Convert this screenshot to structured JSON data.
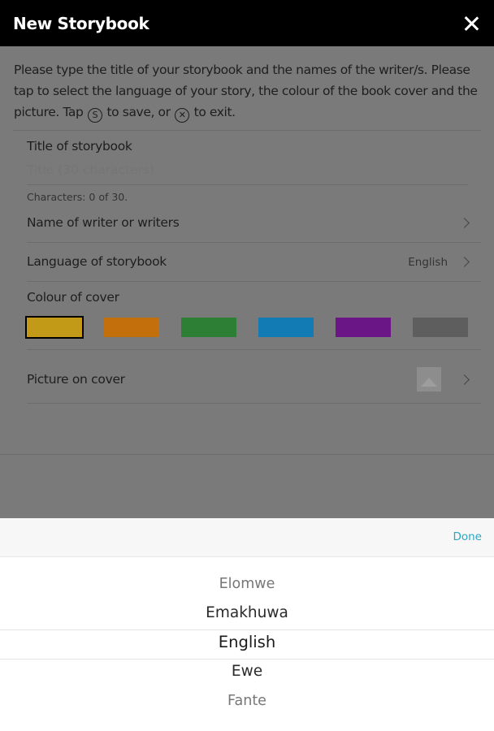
{
  "header": {
    "title": "New Storybook",
    "close_icon": "close-icon"
  },
  "form": {
    "intro_part1": "Please type the title of your storybook and the names of the writer/s. Please tap to select the language of your story, the colour of the book cover and the picture. Tap ",
    "save_glyph": "S",
    "intro_part2": " to save, or ",
    "exit_glyph": "✕",
    "intro_part3": " to exit.",
    "title_label": "Title of storybook",
    "title_placeholder": "Title (30 characters)",
    "title_value": "",
    "char_count": "Characters: 0 of 30.",
    "writers_label": "Name of writer or writers",
    "language_label": "Language of storybook",
    "language_value": "English",
    "colour_label": "Colour of cover",
    "colours": [
      "#c29a18",
      "#c36f0b",
      "#2e7f36",
      "#127bb4",
      "#6b1686",
      "#5e5e5e"
    ],
    "selected_colour_index": 0,
    "picture_label": "Picture on cover",
    "picture_icon": "image-icon"
  },
  "picker": {
    "done_label": "Done",
    "options": [
      "Elomwe",
      "Emakhuwa",
      "English",
      "Ewe",
      "Fante"
    ],
    "selected": "English"
  }
}
